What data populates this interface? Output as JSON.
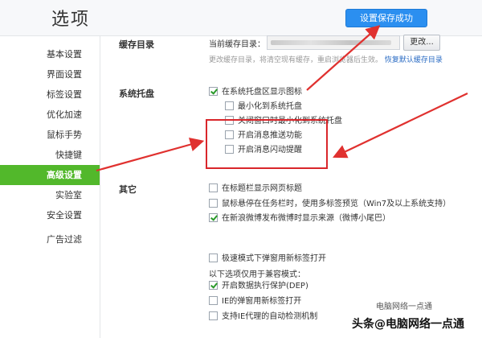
{
  "page": {
    "title": "选项"
  },
  "toast": {
    "label": "设置保存成功"
  },
  "sidebar": {
    "items": [
      {
        "label": "基本设置"
      },
      {
        "label": "界面设置"
      },
      {
        "label": "标签设置"
      },
      {
        "label": "优化加速"
      },
      {
        "label": "鼠标手势"
      },
      {
        "label": "快捷键"
      },
      {
        "label": "高级设置",
        "active": true
      },
      {
        "label": "实验室"
      },
      {
        "label": "安全设置"
      },
      {
        "label": "广告过滤"
      }
    ]
  },
  "cache": {
    "title": "缓存目录",
    "current_label": "当前缓存目录：",
    "change_button": "更改...",
    "hint": "更改缓存目录，将清空现有缓存，重启浏览器后生效。",
    "restore_link": "恢复默认缓存目录"
  },
  "tray": {
    "title": "系统托盘",
    "options": [
      {
        "label": "在系统托盘区显示图标",
        "checked": true
      },
      {
        "label": "最小化到系统托盘",
        "checked": false
      },
      {
        "label": "关闭窗口时最小化到系统托盘",
        "checked": false
      },
      {
        "label": "开启消息推送功能",
        "checked": false
      },
      {
        "label": "开启消息闪动提醒",
        "checked": false
      }
    ]
  },
  "other": {
    "title": "其它",
    "options": [
      {
        "label": "在标题栏显示网页标题",
        "checked": false
      },
      {
        "label": "鼠标悬停在任务栏时，使用多标签预览（Win7及以上系统支持）",
        "checked": false
      },
      {
        "label": "在新浪微博发布微博时显示来源（微博小尾巴）",
        "checked": true
      },
      {
        "label": "极速模式下弹窗用新标签打开",
        "checked": false
      }
    ],
    "compat_label": "以下选项仅用于兼容模式：",
    "compat_options": [
      {
        "label": "开启数据执行保护(DEP)",
        "checked": true
      },
      {
        "label": "IE的弹窗用新标签打开",
        "checked": false
      },
      {
        "label": "支持IE代理的自动检测机制",
        "checked": false
      }
    ]
  },
  "watermark": {
    "line1": "电脑网络一点通",
    "line2": "头条@电脑网络一点通"
  },
  "colors": {
    "accent_green": "#52b82b",
    "toast_blue": "#2b8ff0",
    "arrow_red": "#e0312f"
  }
}
